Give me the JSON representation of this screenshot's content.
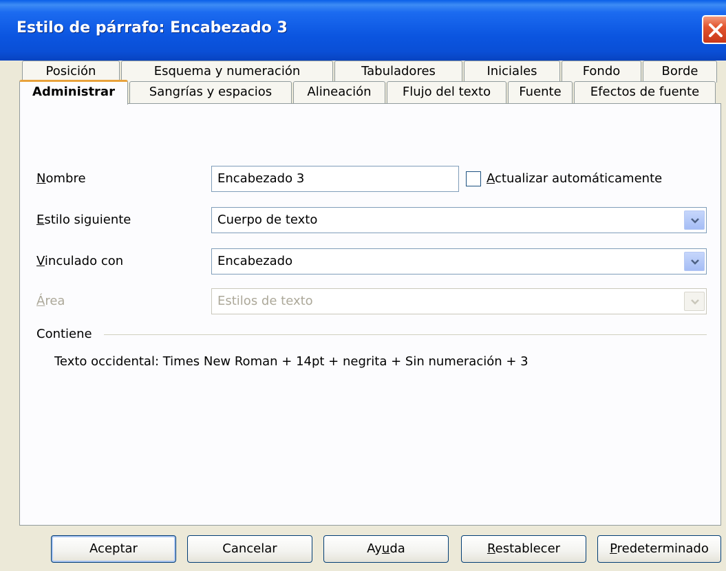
{
  "window": {
    "title": "Estilo de párrafo: Encabezado 3"
  },
  "tabs_row1": [
    {
      "label": "Posición"
    },
    {
      "label": "Esquema y numeración"
    },
    {
      "label": "Tabuladores"
    },
    {
      "label": "Iniciales"
    },
    {
      "label": "Fondo"
    },
    {
      "label": "Borde"
    }
  ],
  "tabs_row2": [
    {
      "label": "Administrar",
      "active": true
    },
    {
      "label": "Sangrías y espacios"
    },
    {
      "label": "Alineación"
    },
    {
      "label": "Flujo del texto"
    },
    {
      "label": "Fuente"
    },
    {
      "label": "Efectos de fuente"
    }
  ],
  "form": {
    "name": {
      "label_mnemonic": "N",
      "label_rest": "ombre",
      "value": "Encabezado 3"
    },
    "autoupdate": {
      "label_mnemonic": "A",
      "label_rest": "ctualizar automáticamente",
      "checked": false
    },
    "next_style": {
      "label_mnemonic": "E",
      "label_rest": "stilo siguiente",
      "value": "Cuerpo de texto"
    },
    "linked_with": {
      "label_mnemonic": "V",
      "label_rest": "inculado con",
      "value": "Encabezado"
    },
    "area": {
      "label_mnemonic": "Á",
      "label_rest": "rea",
      "value": "Estilos de texto",
      "disabled": true
    }
  },
  "contains": {
    "heading": "Contiene",
    "text": "Texto occidental: Times New Roman + 14pt + negrita + Sin numeración + 3"
  },
  "buttons": {
    "ok": "Aceptar",
    "cancel": "Cancelar",
    "help_pre": "Ay",
    "help_mnemonic": "u",
    "help_post": "da",
    "reset_mnemonic": "R",
    "reset_rest": "establecer",
    "default_mnemonic": "P",
    "default_rest": "redeterminado"
  },
  "colors": {
    "titlebar": "#0A4FD6",
    "dialog_bg": "#ECE9D8",
    "active_tab_accent": "#E8A23C",
    "close_button": "#E2552F"
  }
}
